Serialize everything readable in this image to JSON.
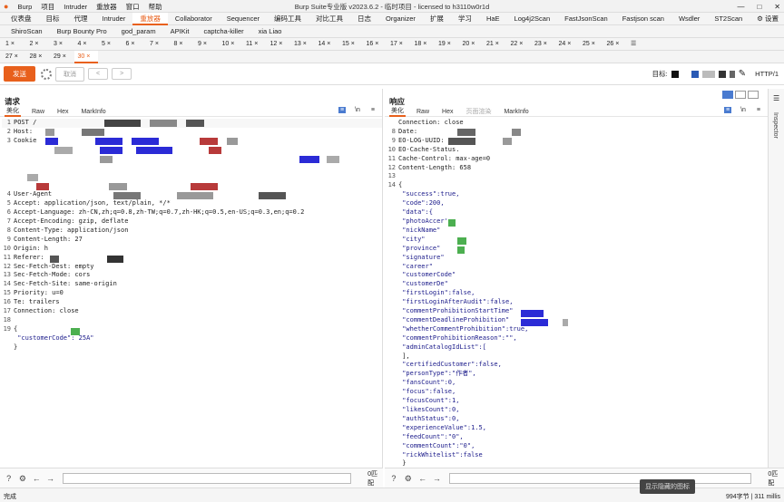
{
  "window": {
    "title": "Burp Suite专业版  v2023.6.2 - 临时项目 - licensed to h3110w0r1d",
    "menu": [
      "Burp",
      "项目",
      "Intruder",
      "重放器",
      "窗口",
      "帮助"
    ]
  },
  "tools": [
    "仪表盘",
    "目标",
    "代理",
    "Intruder",
    "重放器",
    "Collaborator",
    "Sequencer",
    "编码工具",
    "对比工具",
    "日志",
    "Organizer",
    "扩展",
    "学习",
    "HaE",
    "Log4j2Scan",
    "FastJsonScan",
    "Fastjson scan",
    "Wsdler",
    "ST2Scan",
    "设置"
  ],
  "extensions": [
    "ShiroScan",
    "Burp Bounty Pro",
    "god_param",
    "APIKit",
    "captcha-killer",
    "xia Liao"
  ],
  "tabs": [
    "1 ×",
    "2 ×",
    "3 ×",
    "4 ×",
    "5 ×",
    "6 ×",
    "7 ×",
    "8 ×",
    "9 ×",
    "10 ×",
    "11 ×",
    "12 ×",
    "13 ×",
    "14 ×",
    "15 ×",
    "16 ×",
    "17 ×",
    "18 ×",
    "19 ×",
    "20 ×",
    "21 ×",
    "22 ×",
    "23 ×",
    "24 ×",
    "25 ×",
    "26 ×",
    "27 ×",
    "28 ×",
    "29 ×",
    "30 ×"
  ],
  "toolbar": {
    "send": "发送",
    "cancel": "取消",
    "back": "<",
    "fwd": ">",
    "target_label": "目标:",
    "http": "HTTP/1"
  },
  "request": {
    "title": "请求",
    "tabs": [
      "美化",
      "Raw",
      "Hex",
      "MarkInfo"
    ],
    "lines": [
      {
        "n": "1",
        "t": "POST /"
      },
      {
        "n": "2",
        "t": "Host:"
      },
      {
        "n": "3",
        "t": "Cookie"
      },
      {
        "n": "",
        "t": ""
      },
      {
        "n": "",
        "t": ""
      },
      {
        "n": "",
        "t": ""
      },
      {
        "n": "",
        "t": ""
      },
      {
        "n": "",
        "t": ""
      },
      {
        "n": "4",
        "t": "User-Agent"
      },
      {
        "n": "5",
        "t": "Accept: application/json, text/plain, */*"
      },
      {
        "n": "6",
        "t": "Accept-Language: zh-CN,zh;q=0.8,zh-TW;q=0.7,zh-HK;q=0.5,en-US;q=0.3,en;q=0.2"
      },
      {
        "n": "7",
        "t": "Accept-Encoding: gzip, deflate"
      },
      {
        "n": "8",
        "t": "Content-Type: application/json"
      },
      {
        "n": "9",
        "t": "Content-Length: 27"
      },
      {
        "n": "10",
        "t": "Origin: h"
      },
      {
        "n": "11",
        "t": "Referer:"
      },
      {
        "n": "12",
        "t": "Sec-Fetch-Dest: empty"
      },
      {
        "n": "13",
        "t": "Sec-Fetch-Mode: cors"
      },
      {
        "n": "14",
        "t": "Sec-Fetch-Site: same-origin"
      },
      {
        "n": "15",
        "t": "Priority: u=0"
      },
      {
        "n": "16",
        "t": "Te: trailers"
      },
      {
        "n": "17",
        "t": "Connection: close"
      },
      {
        "n": "18",
        "t": ""
      },
      {
        "n": "19",
        "t": "{"
      },
      {
        "n": "",
        "t": "  \"customerCode\":    25A\""
      },
      {
        "n": "",
        "t": "}"
      }
    ]
  },
  "response": {
    "title": "响应",
    "tabs": [
      "美化",
      "Raw",
      "Hex",
      "页面渲染",
      "MarkInfo"
    ],
    "lines": [
      {
        "n": "",
        "t": "Connection: close"
      },
      {
        "n": "8",
        "t": "Date:"
      },
      {
        "n": "9",
        "t": "EO-LOG-UUID:"
      },
      {
        "n": "10",
        "t": "EO-Cache-Status."
      },
      {
        "n": "11",
        "t": "Cache-Control: max-age=0"
      },
      {
        "n": "12",
        "t": "Content-Length: 658"
      },
      {
        "n": "13",
        "t": ""
      },
      {
        "n": "14",
        "t": "{"
      },
      {
        "n": "",
        "t": "  \"success\":true,"
      },
      {
        "n": "",
        "t": "  \"code\":200,"
      },
      {
        "n": "",
        "t": "  \"data\":{"
      },
      {
        "n": "",
        "t": "    \"photoAccer'"
      },
      {
        "n": "",
        "t": "    \"nickName\""
      },
      {
        "n": "",
        "t": "    \"city\""
      },
      {
        "n": "",
        "t": "    \"province\""
      },
      {
        "n": "",
        "t": "    \"signature\""
      },
      {
        "n": "",
        "t": "    \"career\""
      },
      {
        "n": "",
        "t": "    \"customerCode\""
      },
      {
        "n": "",
        "t": "    \"customerDe\""
      },
      {
        "n": "",
        "t": "    \"firstLogin\":false,"
      },
      {
        "n": "",
        "t": "    \"firstLoginAfterAudit\":false,"
      },
      {
        "n": "",
        "t": "    \"commentProhibitionStartTime\""
      },
      {
        "n": "",
        "t": "    \"commentDeadlineProhibition\""
      },
      {
        "n": "",
        "t": "    \"whetherCommentProhibition\":true,"
      },
      {
        "n": "",
        "t": "    \"commentProhibitionReason\":\"\","
      },
      {
        "n": "",
        "t": "    \"adminCatalogIdList\":["
      },
      {
        "n": "",
        "t": "    ],"
      },
      {
        "n": "",
        "t": "    \"certifiedCustomer\":false,"
      },
      {
        "n": "",
        "t": "    \"personType\":\"作者\","
      },
      {
        "n": "",
        "t": "    \"fansCount\":0,"
      },
      {
        "n": "",
        "t": "    \"focus\":false,"
      },
      {
        "n": "",
        "t": "    \"focusCount\":1,"
      },
      {
        "n": "",
        "t": "    \"likesCount\":0,"
      },
      {
        "n": "",
        "t": "    \"authStatus\":0,"
      },
      {
        "n": "",
        "t": "    \"experienceValue\":1.5,"
      },
      {
        "n": "",
        "t": "    \"feedCount\":\"0\","
      },
      {
        "n": "",
        "t": "    \"commentCount\":\"0\","
      },
      {
        "n": "",
        "t": "    \"rickWhitelist\":false"
      },
      {
        "n": "",
        "t": "  }"
      },
      {
        "n": "",
        "t": "}"
      }
    ]
  },
  "inspector": "Inspector",
  "search": {
    "req_count": "0匹配",
    "resp_count": "0匹配"
  },
  "status": {
    "left": "完成",
    "right": "994字节 | 311 millis",
    "tooltip": "显示隐藏的图标"
  },
  "colors": {
    "accent": "#e8601c",
    "redact_blue": "#2b2bd6",
    "redact_red": "#b83a3a",
    "redact_green": "#4caf50"
  }
}
